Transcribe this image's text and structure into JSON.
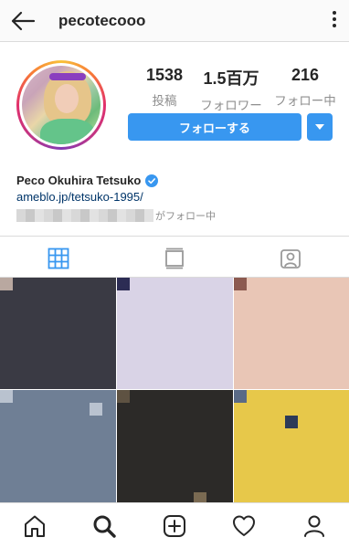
{
  "header": {
    "username": "pecotecooo",
    "back_icon": "back-arrow-icon",
    "more_icon": "more-vertical-icon"
  },
  "profile": {
    "stats": [
      {
        "value": "1538",
        "label": "投稿"
      },
      {
        "value": "1.5百万",
        "label": "フォロワー"
      },
      {
        "value": "216",
        "label": "フォロー中"
      }
    ],
    "follow_label": "フォローする",
    "full_name": "Peco Okuhira Tetsuko",
    "bio_link": "ameblo.jp/tetsuko-1995/",
    "followed_by_suffix": "がフォロー中",
    "accent_color": "#3897f0"
  },
  "tabs": [
    {
      "icon": "grid-icon",
      "active": true
    },
    {
      "icon": "feed-icon",
      "active": false
    },
    {
      "icon": "tagged-icon",
      "active": false
    }
  ],
  "bottom_nav": [
    {
      "icon": "home-icon"
    },
    {
      "icon": "search-icon"
    },
    {
      "icon": "add-post-icon"
    },
    {
      "icon": "activity-heart-icon"
    },
    {
      "icon": "profile-icon"
    }
  ]
}
